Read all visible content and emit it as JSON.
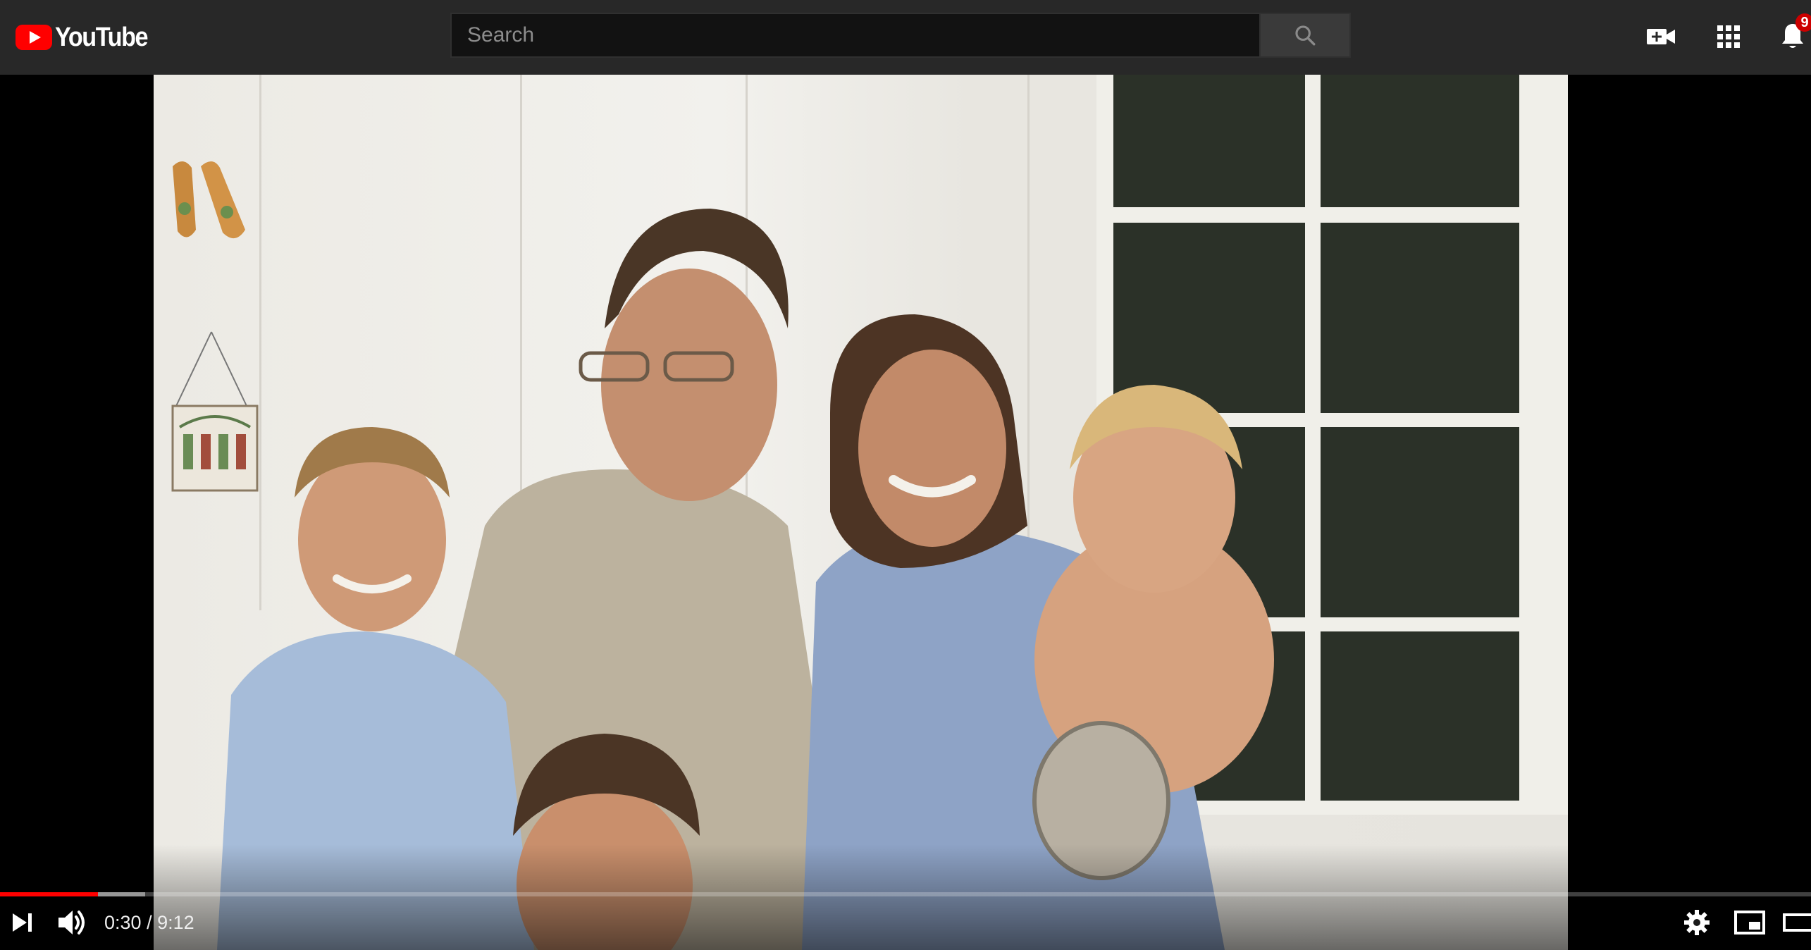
{
  "app": {
    "logo_text": "YouTube",
    "brand_color": "#ff0000",
    "header_bg": "#282828"
  },
  "search": {
    "placeholder": "Search",
    "value": "",
    "button_icon": "search-icon"
  },
  "header_icons": {
    "create": "video-camera-plus-icon",
    "apps": "apps-grid-icon",
    "notifications": "bell-icon",
    "notification_count": "9"
  },
  "player": {
    "current_time": "0:30",
    "separator": " / ",
    "duration": "9:12",
    "played_fraction": 0.054,
    "buffered_fraction": 0.08,
    "progress_color": "#ff0000",
    "left_controls": [
      "next-icon",
      "volume-icon"
    ],
    "right_controls": [
      "settings-gear-icon",
      "miniplayer-icon",
      "theater-mode-icon"
    ]
  },
  "video_content": "family-photo"
}
